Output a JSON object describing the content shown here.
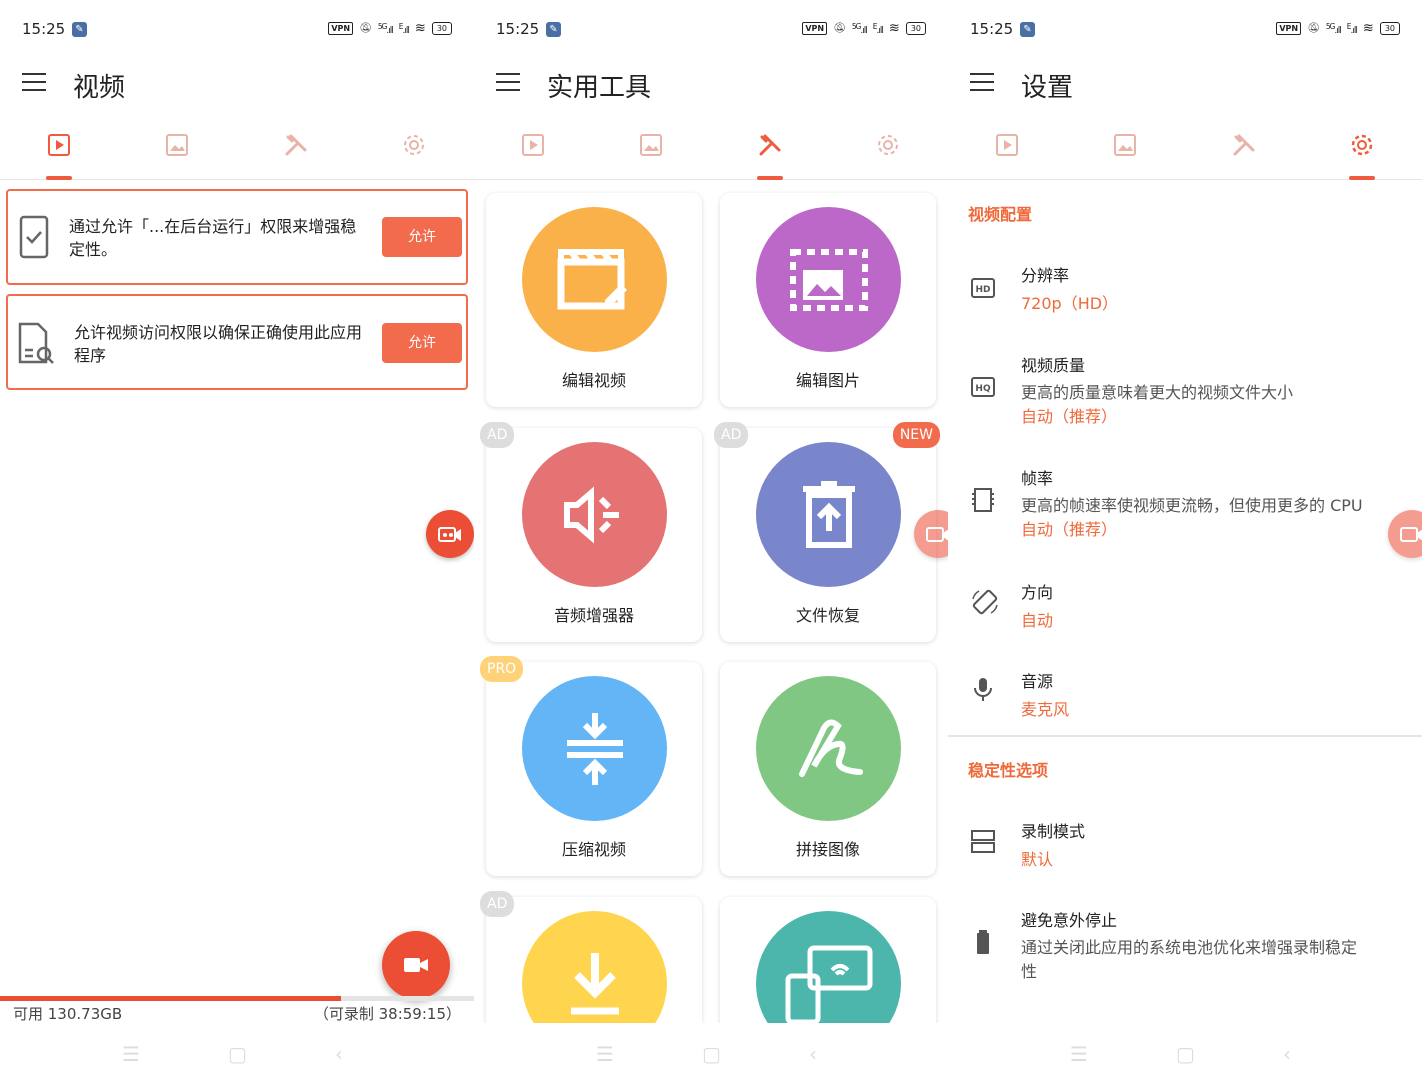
{
  "status": {
    "time": "15:25",
    "vpn": "VPN",
    "signal": "5G",
    "battery": "30"
  },
  "p1": {
    "title": "视频",
    "cards": [
      {
        "text": "通过允许「...在后台运行」权限来增强稳定性。",
        "btn": "允许"
      },
      {
        "text": "允许视频访问权限以确保正确使用此应用程序",
        "btn": "允许"
      }
    ],
    "storage": {
      "available": "可用 130.73GB",
      "remaining": "（可录制 38:59:15）",
      "progress": 0.72
    }
  },
  "p2": {
    "title": "实用工具",
    "tools": [
      {
        "label": "编辑视频",
        "color": "#fbb14a",
        "icon": "clapperboard-icon",
        "badge": ""
      },
      {
        "label": "编辑图片",
        "color": "#bb68c8",
        "icon": "image-edit-icon",
        "badge": ""
      },
      {
        "label": "音频增强器",
        "color": "#e57373",
        "icon": "speaker-icon",
        "badge": "AD"
      },
      {
        "label": "文件恢复",
        "color": "#7986cb",
        "icon": "trash-restore-icon",
        "badge": "AD",
        "badge2": "NEW"
      },
      {
        "label": "压缩视频",
        "color": "#64b5f6",
        "icon": "compress-icon",
        "badge": "PRO"
      },
      {
        "label": "拼接图像",
        "color": "#81c784",
        "icon": "stitch-icon",
        "badge": ""
      },
      {
        "label": "",
        "color": "#ffd54f",
        "icon": "download-icon",
        "badge": "AD"
      },
      {
        "label": "",
        "color": "#4db6ac",
        "icon": "cast-icon",
        "badge": ""
      }
    ]
  },
  "p3": {
    "title": "设置",
    "sec1": "视频配置",
    "sec2": "稳定性选项",
    "items": [
      {
        "title": "分辨率",
        "value": "720p（HD）",
        "icon": "hd-icon"
      },
      {
        "title": "视频质量",
        "desc": "更高的质量意味着更大的视频文件大小",
        "value": "自动（推荐）",
        "icon": "hq-icon"
      },
      {
        "title": "帧率",
        "desc": "更高的帧速率使视频更流畅，但使用更多的 CPU",
        "value": "自动（推荐）",
        "icon": "film-icon"
      },
      {
        "title": "方向",
        "value": "自动",
        "icon": "rotate-icon"
      },
      {
        "title": "音源",
        "value": "麦克风",
        "icon": "mic-icon"
      },
      {
        "title": "录制模式",
        "value": "默认",
        "icon": "layout-icon"
      },
      {
        "title": "避免意外停止",
        "desc": "通过关闭此应用的系统电池优化来增强录制稳定",
        "desc2": "性",
        "icon": "battery-icon"
      }
    ]
  },
  "colors": {
    "accent": "#ef5b3c",
    "inactive": "#e8b4a8"
  }
}
